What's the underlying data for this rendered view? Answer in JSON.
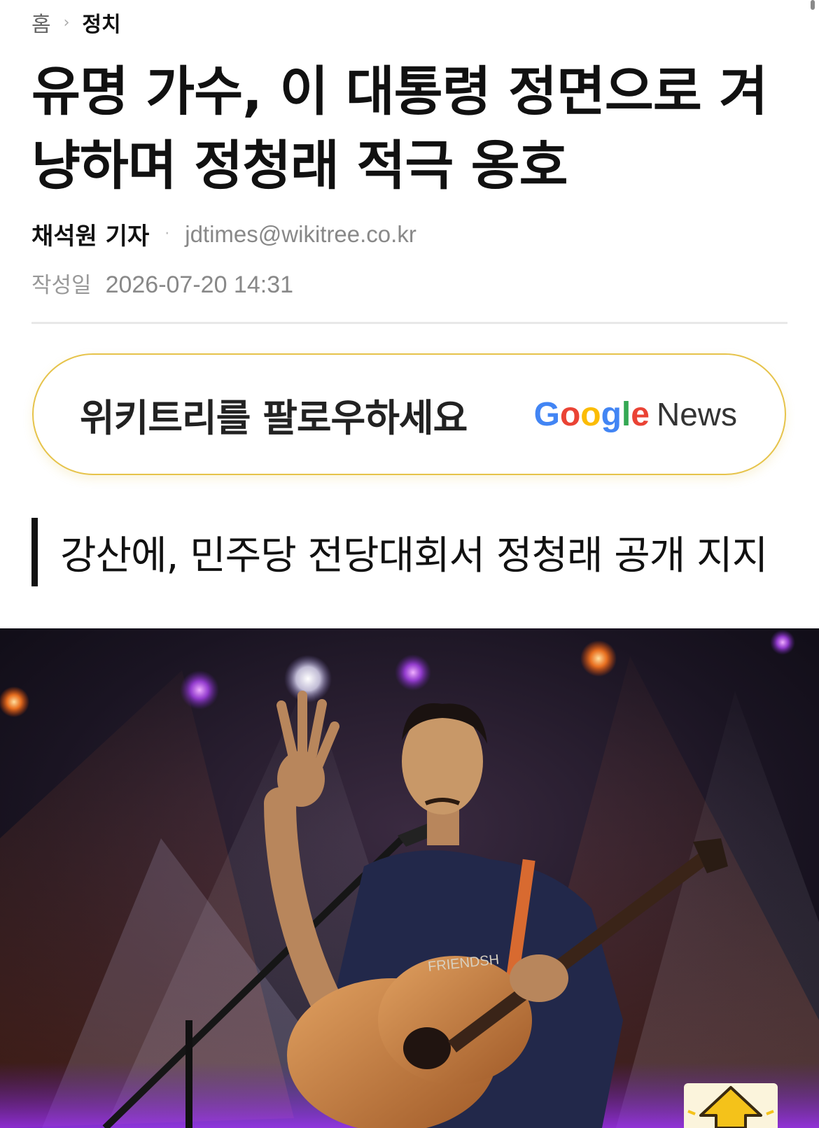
{
  "breadcrumb": {
    "home": "홈",
    "separator": "›",
    "current": "정치"
  },
  "article": {
    "title": "유명 가수, 이 대통령 정면으로 겨냥하며 정청래 적극 옹호",
    "author": "채석원 기자",
    "email": "jdtimes@wikitree.co.kr",
    "date_label": "작성일",
    "date_value": "2026-07-20 14:31",
    "subheadline": "강산에, 민주당 전당대회서 정청래 공개 지지"
  },
  "follow_banner": {
    "text": "위키트리를 팔로우하세요",
    "google_letters": [
      "G",
      "o",
      "o",
      "g",
      "l",
      "e"
    ],
    "google_colors": [
      "#4285F4",
      "#EA4335",
      "#FBBC05",
      "#4285F4",
      "#34A853",
      "#EA4335"
    ],
    "news_label": "News"
  },
  "photo": {
    "shirt_text": "FRIENDSH"
  },
  "icons": {
    "breadcrumb_sep": "chevron-right-icon",
    "top_button": "arrow-up-icon"
  },
  "colors": {
    "banner_border": "#e6c34a",
    "subhead_bar": "#111111",
    "top_button_bg": "#fbf4dc"
  }
}
